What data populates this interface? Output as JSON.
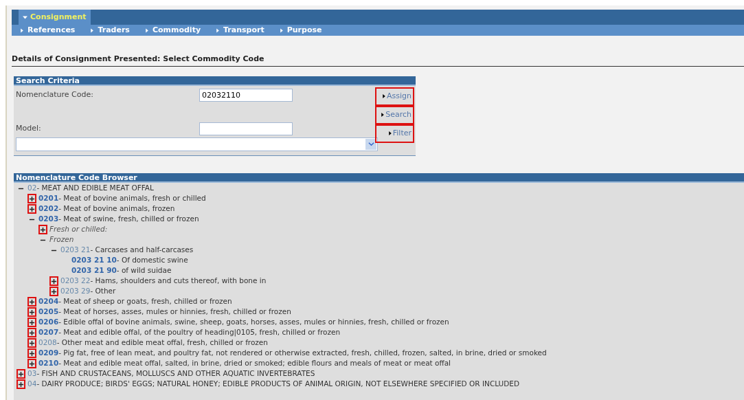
{
  "nav": {
    "main_tabs": [
      {
        "label": "Consignment",
        "selected": true
      }
    ],
    "sub_tabs": [
      {
        "label": "References"
      },
      {
        "label": "Traders"
      },
      {
        "label": "Commodity"
      },
      {
        "label": "Transport"
      },
      {
        "label": "Purpose"
      }
    ]
  },
  "page_title": "Details of Consignment Presented: Select Commodity Code",
  "search_criteria": {
    "title": "Search Criteria",
    "fields": [
      {
        "label": "Nomenclature Code:",
        "value": "02032110"
      },
      {
        "label": "Model:"
      }
    ],
    "actions": [
      {
        "label": "Assign",
        "highlighted": true
      },
      {
        "label": "Search",
        "highlighted": true
      },
      {
        "label": "Filter",
        "highlighted": true
      }
    ]
  },
  "browser": {
    "title": "Nomenclature Code Browser",
    "tree": [
      {
        "kind": "branch",
        "expanded": true,
        "highlighted": false,
        "code": "02",
        "bold": false,
        "text": "- MEAT AND EDIBLE MEAT OFFAL",
        "children": [
          {
            "kind": "branch",
            "expanded": false,
            "highlighted": true,
            "code": "0201",
            "bold": true,
            "text": "- Meat of bovine animals, fresh or chilled"
          },
          {
            "kind": "branch",
            "expanded": false,
            "highlighted": true,
            "code": "0202",
            "bold": true,
            "text": "- Meat of bovine animals, frozen"
          },
          {
            "kind": "branch",
            "expanded": true,
            "highlighted": false,
            "code": "0203",
            "bold": true,
            "text": "- Meat of swine, fresh, chilled or frozen",
            "children": [
              {
                "kind": "group",
                "expanded": false,
                "highlighted": true,
                "text": "Fresh or chilled:"
              },
              {
                "kind": "group",
                "expanded": true,
                "highlighted": false,
                "text": "Frozen",
                "children": [
                  {
                    "kind": "branch",
                    "expanded": true,
                    "highlighted": false,
                    "code": "0203 21",
                    "bold": false,
                    "text": "- Carcases and half-carcases",
                    "children": [
                      {
                        "kind": "leaf",
                        "code": "0203 21 10",
                        "bold": true,
                        "text": "- Of domestic swine"
                      },
                      {
                        "kind": "leaf",
                        "code": "0203 21 90",
                        "bold": true,
                        "text": "- of wild suidae"
                      }
                    ]
                  },
                  {
                    "kind": "branch",
                    "expanded": false,
                    "highlighted": true,
                    "code": "0203 22",
                    "bold": false,
                    "text": "- Hams, shoulders and cuts thereof, with bone in"
                  },
                  {
                    "kind": "branch",
                    "expanded": false,
                    "highlighted": true,
                    "code": "0203 29",
                    "bold": false,
                    "text": "- Other"
                  }
                ]
              }
            ]
          },
          {
            "kind": "branch",
            "expanded": false,
            "highlighted": true,
            "code": "0204",
            "bold": true,
            "text": "- Meat of sheep or goats, fresh, chilled or frozen"
          },
          {
            "kind": "branch",
            "expanded": false,
            "highlighted": true,
            "code": "0205",
            "bold": true,
            "text": "- Meat of horses, asses, mules or hinnies, fresh, chilled or frozen"
          },
          {
            "kind": "branch",
            "expanded": false,
            "highlighted": true,
            "code": "0206",
            "bold": true,
            "text": "- Edible offal of bovine animals, swine, sheep, goats, horses, asses, mules or hinnies, fresh, chilled or frozen"
          },
          {
            "kind": "branch",
            "expanded": false,
            "highlighted": true,
            "code": "0207",
            "bold": true,
            "text": "- Meat and edible offal, of the poultry of heading|0105, fresh, chilled or frozen"
          },
          {
            "kind": "branch",
            "expanded": false,
            "highlighted": true,
            "code": "0208",
            "bold": false,
            "text": "- Other meat and edible meat offal, fresh, chilled or frozen"
          },
          {
            "kind": "branch",
            "expanded": false,
            "highlighted": true,
            "code": "0209",
            "bold": true,
            "text": "- Pig fat, free of lean meat, and poultry fat, not rendered or otherwise extracted, fresh, chilled, frozen, salted, in brine, dried or smoked"
          },
          {
            "kind": "branch",
            "expanded": false,
            "highlighted": true,
            "code": "0210",
            "bold": true,
            "text": "- Meat and edible meat offal, salted, in brine, dried or smoked; edible flours and meals of meat or meat offal"
          }
        ]
      },
      {
        "kind": "branch",
        "expanded": false,
        "highlighted": true,
        "code": "03",
        "bold": false,
        "text": "- FISH AND CRUSTACEANS, MOLLUSCS AND OTHER AQUATIC INVERTEBRATES"
      },
      {
        "kind": "branch",
        "expanded": false,
        "highlighted": true,
        "code": "04",
        "bold": false,
        "text": "- DAIRY PRODUCE; BIRDS' EGGS; NATURAL HONEY; EDIBLE PRODUCTS OF ANIMAL ORIGIN, NOT ELSEWHERE SPECIFIED OR INCLUDED"
      }
    ]
  }
}
